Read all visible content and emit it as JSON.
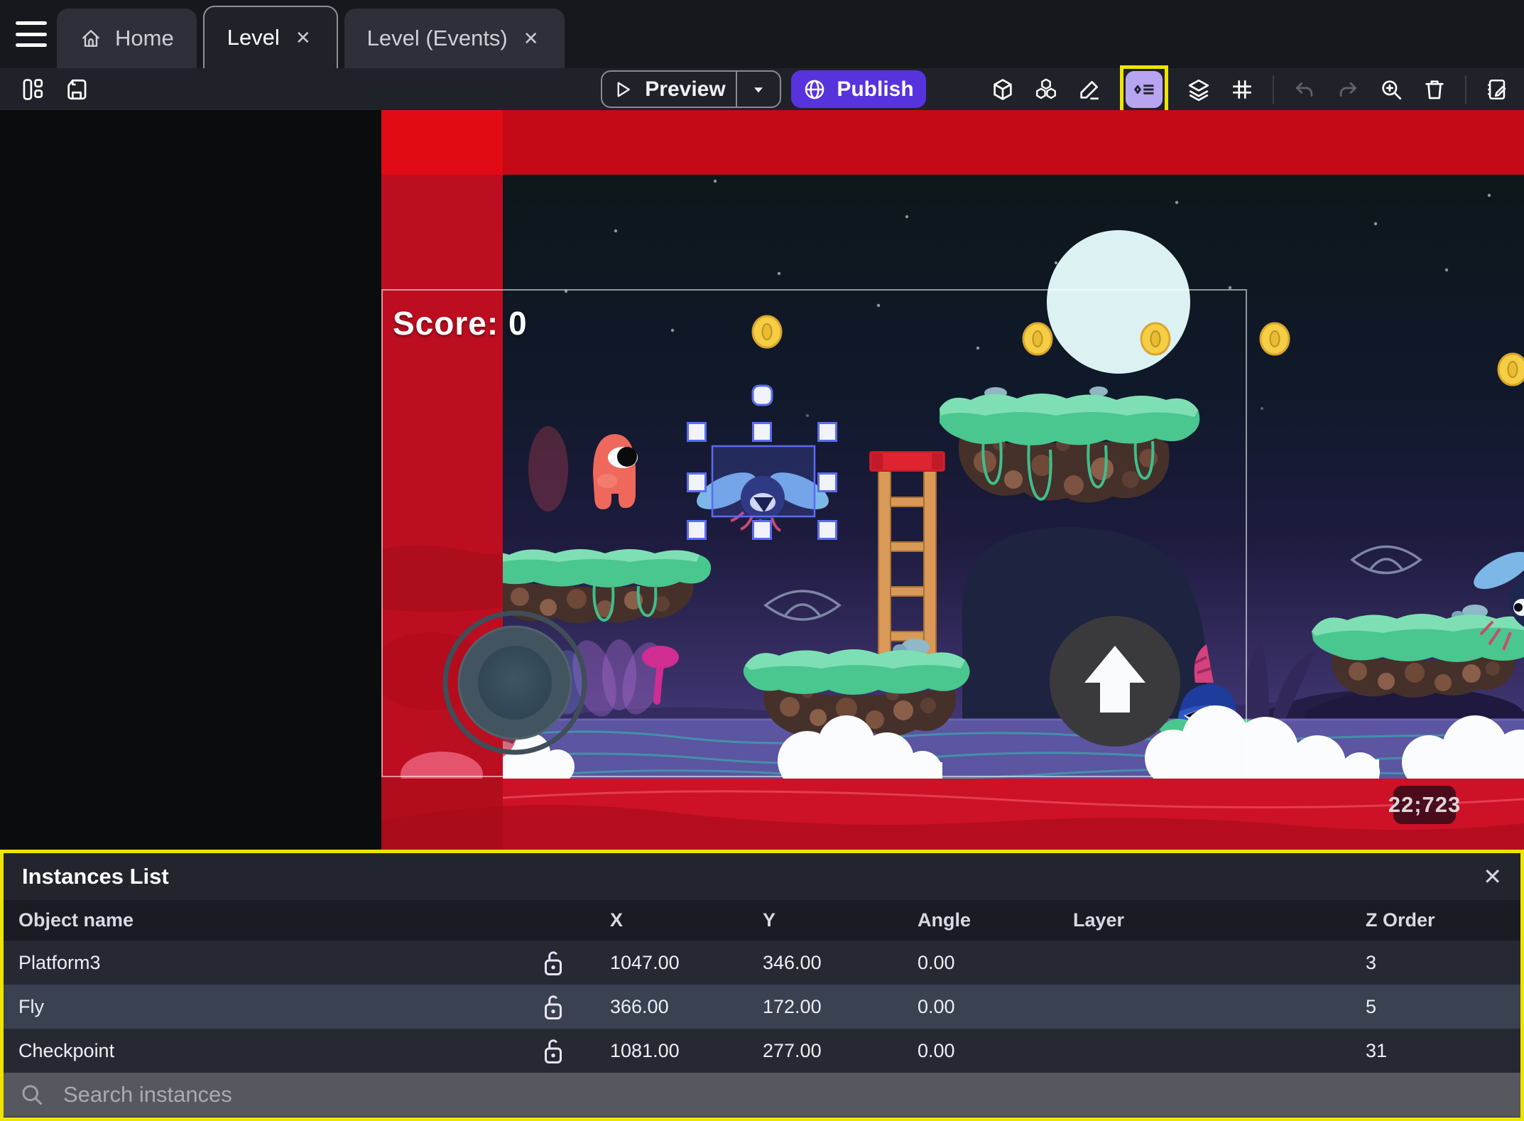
{
  "tabs": {
    "items": [
      {
        "label": "Home"
      },
      {
        "label": "Level"
      },
      {
        "label": "Level (Events)"
      }
    ]
  },
  "toolbar": {
    "preview_label": "Preview",
    "publish_label": "Publish"
  },
  "scene": {
    "score_text": "Score: 0",
    "cursor_coords": "22;723",
    "selected_object": "Fly"
  },
  "panel": {
    "title": "Instances List",
    "columns": [
      "Object name",
      "X",
      "Y",
      "Angle",
      "Layer",
      "Z Order"
    ],
    "rows": [
      {
        "name": "Platform3",
        "x": "1047.00",
        "y": "346.00",
        "angle": "0.00",
        "layer": "",
        "z_order": "3"
      },
      {
        "name": "Fly",
        "x": "366.00",
        "y": "172.00",
        "angle": "0.00",
        "layer": "",
        "z_order": "5"
      },
      {
        "name": "Checkpoint",
        "x": "1081.00",
        "y": "277.00",
        "angle": "0.00",
        "layer": "",
        "z_order": "31"
      }
    ],
    "search_placeholder": "Search instances"
  },
  "icons": {
    "close": "✕"
  },
  "colors": {
    "accent_purple": "#5733dd",
    "highlight_yellow": "#f0e400",
    "selection_blue": "#5a6cf2",
    "red_overlay": "#c30a16",
    "row_dark": "#262932",
    "row_light": "#3a4150",
    "grass_green": "#4ac68f",
    "water_purple": "#5b55a2"
  }
}
